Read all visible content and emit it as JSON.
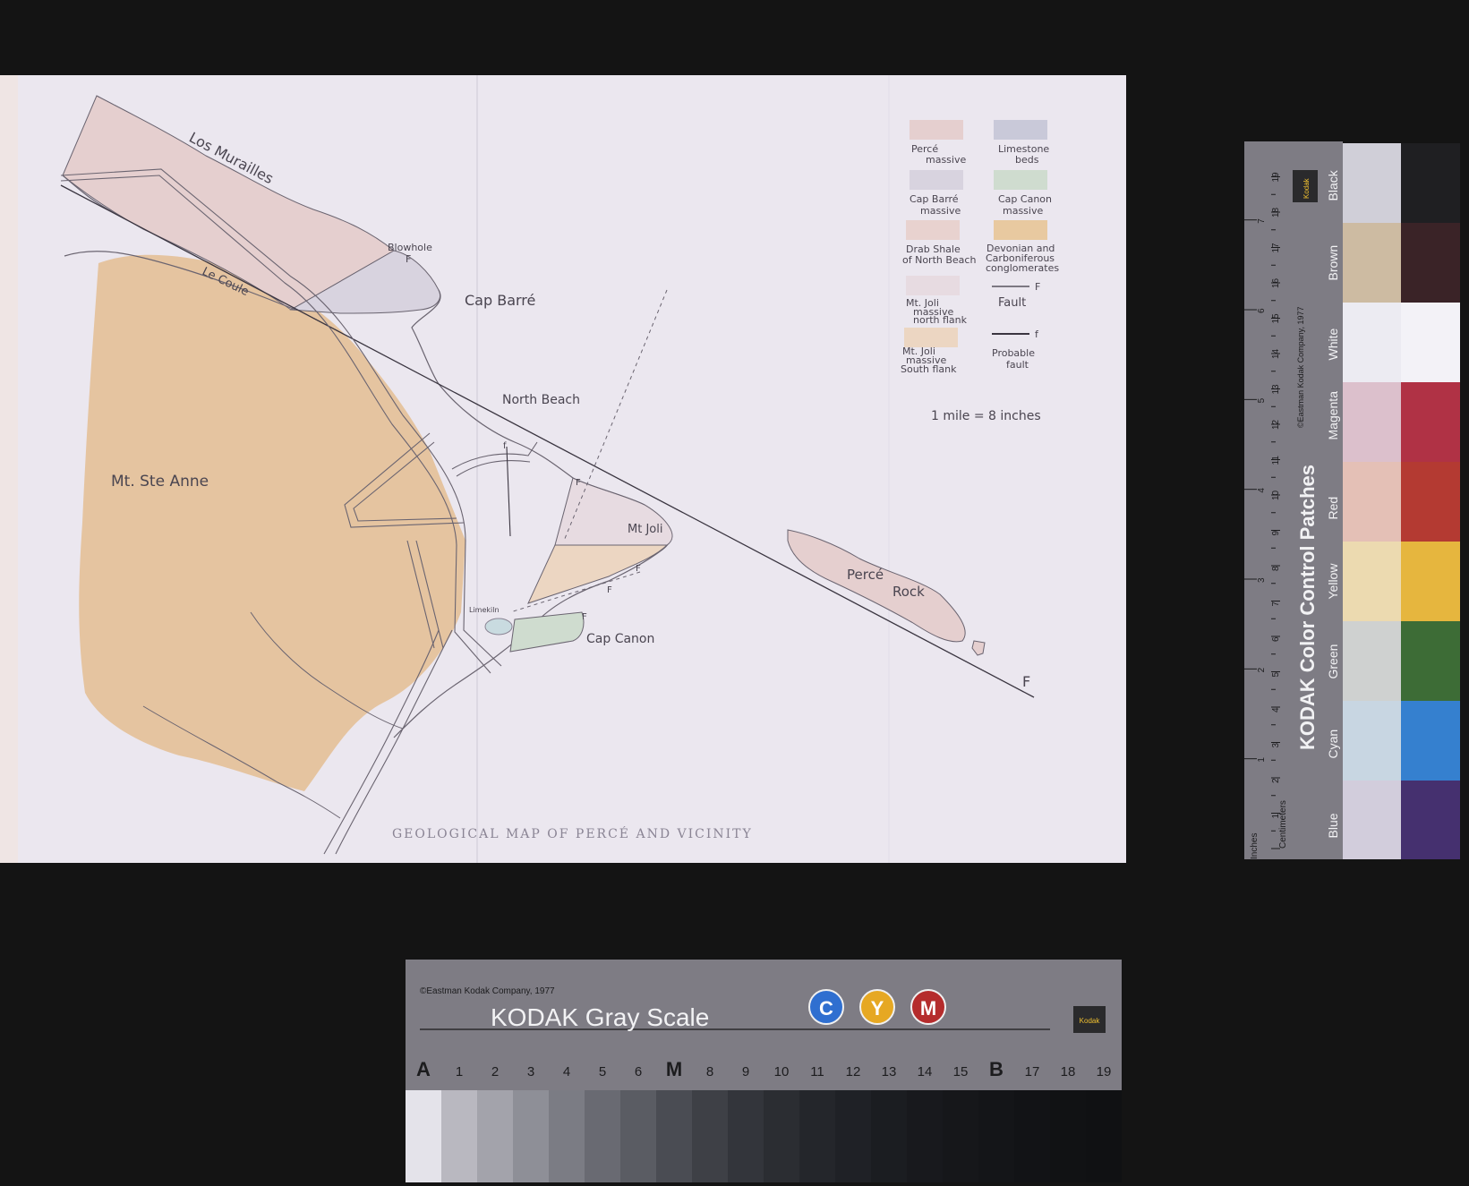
{
  "map": {
    "caption": "GEOLOGICAL MAP OF PERCÉ AND VICINITY",
    "place_labels": {
      "los_murailles": "Los Murailles",
      "le_coule": "Le Coule",
      "blowhole": "Blowhole",
      "blowhole_fault": "F",
      "cap_barre": "Cap Barré",
      "north_beach": "North Beach",
      "mt_ste_anne": "Mt. Ste Anne",
      "mt_joli": "Mt Joli",
      "perce": "Percé",
      "rock": "Rock",
      "cap_canon": "Cap Canon",
      "limekiln": "Limekiln",
      "fault_end": "F",
      "f1": "f",
      "f2": "F",
      "f3": "F",
      "f4": "F",
      "f5": "F"
    },
    "legend": {
      "perce_1": "Percé",
      "perce_2": "massive",
      "limestone_1": "Limestone",
      "limestone_2": "beds",
      "cap_barre_1": "Cap Barré",
      "cap_barre_2": "massive",
      "cap_canon_1": "Cap Canon",
      "cap_canon_2": "massive",
      "drab_1": "Drab Shale",
      "drab_2": "of North Beach",
      "devonian_1": "Devonian and",
      "devonian_2": "Carboniferous",
      "devonian_3": "conglomerates",
      "mtjoli_n_1": "Mt. Joli",
      "mtjoli_n_2": "massive",
      "mtjoli_n_3": "north flank",
      "mtjoli_s_1": "Mt. Joli",
      "mtjoli_s_2": "massive",
      "mtjoli_s_3": "South flank",
      "fault_symbol": "F",
      "fault": "Fault",
      "probable_symbol": "f",
      "probable_1": "Probable",
      "probable_2": "fault",
      "scale": "1 mile = 8 inches"
    },
    "colors": {
      "paper": "#ebe7ef",
      "perce": "#e5cfcf",
      "limestone": "#c9c9d9",
      "cap_barre": "#d8d3df",
      "cap_canon": "#cfdccf",
      "drab": "#e8d2cf",
      "devonian": "#e8c9a0",
      "mtjoli_n": "#e7dbe1",
      "mtjoli_s": "#ecd6c2",
      "ste_anne": "#e5c4a0"
    }
  },
  "color_card": {
    "title": "KODAK Color Control Patches",
    "copyright": "©Eastman Kodak Company, 1977",
    "units_inches": "Inches",
    "units_cm": "Centimeters",
    "brand": "Kodak",
    "cm_ticks": [
      "1",
      "2",
      "3",
      "4",
      "5",
      "6",
      "7",
      "8",
      "9",
      "10",
      "11",
      "12",
      "13",
      "14",
      "15",
      "16",
      "17",
      "18",
      "19"
    ],
    "inch_ticks": [
      "1",
      "2",
      "3",
      "4",
      "5",
      "6",
      "7"
    ],
    "patches": [
      {
        "label": "Black",
        "light": "#d0cfd8",
        "dark": "#1f1f22"
      },
      {
        "label": "Brown",
        "light": "#cdbba2",
        "dark": "#3a2327"
      },
      {
        "label": "White",
        "light": "#ecebf2",
        "dark": "#f3f2f7"
      },
      {
        "label": "Magenta",
        "light": "#dcc0cc",
        "dark": "#b03245"
      },
      {
        "label": "Red",
        "light": "#e4c0b6",
        "dark": "#b43a32"
      },
      {
        "label": "Yellow",
        "light": "#ecdab0",
        "dark": "#e6b63e"
      },
      {
        "label": "Green",
        "light": "#cfd1d0",
        "dark": "#3d6c36"
      },
      {
        "label": "Cyan",
        "light": "#c8d6e2",
        "dark": "#3580cf"
      },
      {
        "label": "Blue",
        "light": "#d2cddc",
        "dark": "#45306f"
      }
    ]
  },
  "gray_card": {
    "copyright": "©Eastman Kodak Company, 1977",
    "title": "KODAK Gray Scale",
    "c_label": "C",
    "y_label": "Y",
    "m_label": "M",
    "brand": "Kodak",
    "steps": [
      "A",
      "1",
      "2",
      "3",
      "4",
      "5",
      "6",
      "M",
      "8",
      "9",
      "10",
      "11",
      "12",
      "13",
      "14",
      "15",
      "B",
      "17",
      "18",
      "19"
    ],
    "shades": [
      "#e4e3ea",
      "#b9b8c0",
      "#a3a3ab",
      "#8e8f97",
      "#7b7c84",
      "#696a72",
      "#5a5c63",
      "#4a4c53",
      "#3e4046",
      "#33353b",
      "#2b2d32",
      "#24262b",
      "#1f2126",
      "#1b1d21",
      "#18191d",
      "#16171a",
      "#141518",
      "#121316",
      "#111214",
      "#101113"
    ]
  }
}
